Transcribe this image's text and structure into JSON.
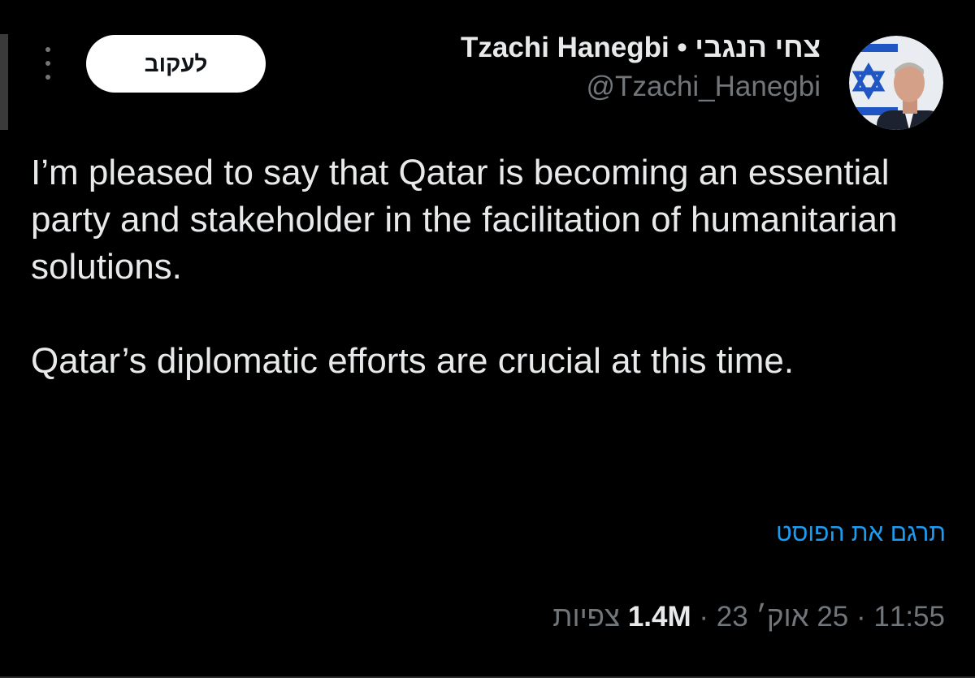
{
  "author": {
    "display_name": "Tzachi Hanegbi • צחי הנגבי",
    "handle": "@Tzachi_Hanegbi"
  },
  "actions": {
    "follow_label": "לעקוב",
    "more_icon": "more-vertical-icon"
  },
  "post": {
    "paragraph_1": "I’m pleased to say that Qatar is becoming an essential party and stakeholder in the facilitation of humanitarian solutions.",
    "paragraph_2": "Qatar’s diplomatic efforts are crucial at this time.",
    "translate_label": "תרגם את הפוסט"
  },
  "meta": {
    "time": "11:55",
    "date": "25 אוק׳ 23",
    "separator": "·",
    "views_count": "1.4M",
    "views_label": "צפיות"
  },
  "colors": {
    "background": "#000000",
    "text_primary": "#e7e9ea",
    "text_secondary": "#71767b",
    "link": "#1d9bf0",
    "button_bg": "#ffffff",
    "button_text": "#0f1419"
  }
}
